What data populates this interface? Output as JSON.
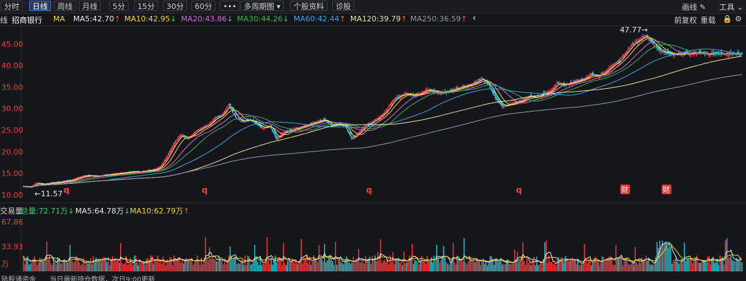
{
  "toolbar": {
    "tabs": [
      "分时",
      "日线",
      "周线",
      "月线",
      "5分",
      "15分",
      "30分",
      "60分",
      "•••"
    ],
    "active_tab": "日线",
    "multi_period": "多周期图 ▾",
    "stock_info": "个股资料",
    "diagnose": "诊股",
    "draw_line": "画线",
    "tools": "工具"
  },
  "ma_bar": {
    "left_cut": "线",
    "stock_name": "招商银行",
    "ma_label": "MA",
    "items": [
      {
        "text": "MA5:42.70",
        "dir": "up",
        "color": "#e8e8e8"
      },
      {
        "text": "MA10:42.95",
        "dir": "down",
        "color": "#f2d52e"
      },
      {
        "text": "MA20:43.86",
        "dir": "down",
        "color": "#e060e6"
      },
      {
        "text": "MA30:44.26",
        "dir": "down",
        "color": "#2fb44e"
      },
      {
        "text": "MA60:42.44",
        "dir": "up",
        "color": "#3aa3e3"
      },
      {
        "text": "MA120:39.79",
        "dir": "up",
        "color": "#e8e0a0"
      },
      {
        "text": "MA250:36.59",
        "dir": "up",
        "color": "#9098a8"
      }
    ],
    "collapse": "‹",
    "restore": "前复权",
    "reset": "重载"
  },
  "volume_bar": {
    "title": "交易量",
    "total": "总量:72.71万",
    "total_dir": "down",
    "ma5": "MA5:64.78万",
    "ma5_dir": "down",
    "ma10": "MA10:62.79万",
    "ma10_dir": "up"
  },
  "footer": {
    "text_1": "陆股通资金",
    "text_2": "当日最新持仓数据，次日9:00更新"
  },
  "colors": {
    "up": "#ff3b3b",
    "down": "#20c9d6",
    "ma5": "#e8e8e8",
    "ma10": "#f2d52e",
    "ma20": "#e060e6",
    "ma30": "#2fb44e",
    "ma60": "#3aa3e3",
    "ma120": "#e8e0a0",
    "ma250": "#9098a8"
  },
  "chart_data": [
    {
      "type": "candlestick",
      "stock": "招商银行",
      "y_ticks": [
        "45.00",
        "40.00",
        "35.00",
        "30.00",
        "25.00",
        "20.00",
        "15.00",
        "10.00"
      ],
      "ylim": [
        9.5,
        48.5
      ],
      "grid": false,
      "annotations": {
        "high": "47.77→",
        "low": "←11.57"
      },
      "markers": [
        "q",
        "q",
        "q",
        "q",
        "财",
        "财"
      ],
      "close_series": {
        "index": [
          0,
          5,
          10,
          15,
          20,
          25,
          30,
          35,
          40,
          45,
          50,
          55,
          60,
          65,
          70,
          75,
          80,
          85,
          90,
          95,
          100,
          105,
          110,
          115,
          120,
          125,
          130,
          135,
          140,
          145,
          150,
          155,
          160,
          165,
          170,
          175,
          180,
          185,
          190,
          195,
          200,
          205,
          210,
          215,
          220,
          225,
          230,
          235,
          240,
          245,
          250,
          255,
          260,
          265,
          270,
          275,
          280,
          285,
          290,
          295,
          300,
          305,
          310,
          315,
          320,
          325,
          330,
          335,
          340,
          345,
          350,
          355,
          360,
          365,
          370,
          375,
          380,
          385,
          390,
          395,
          400,
          405,
          410,
          415,
          420,
          425,
          430,
          435,
          440,
          445,
          450,
          455,
          460,
          465,
          470,
          475,
          480,
          485,
          490,
          495,
          500,
          505,
          510,
          515,
          520,
          525
        ],
        "values": [
          12.0,
          11.8,
          12.8,
          12.4,
          12.8,
          12.9,
          13.2,
          13.4,
          14.0,
          14.5,
          14.4,
          14.3,
          14.6,
          14.8,
          15.0,
          15.2,
          15.4,
          15.3,
          15.6,
          15.8,
          16.5,
          19.0,
          22.0,
          24.0,
          23.0,
          24.5,
          25.5,
          26.2,
          27.8,
          28.5,
          31.0,
          28.0,
          27.0,
          27.5,
          26.5,
          25.5,
          26.0,
          23.0,
          24.5,
          25.0,
          25.5,
          26.0,
          26.5,
          27.0,
          27.5,
          26.0,
          26.5,
          26.0,
          23.0,
          24.5,
          26.0,
          27.0,
          28.0,
          29.5,
          32.0,
          33.0,
          33.5,
          33.0,
          33.5,
          34.5,
          34.0,
          33.5,
          34.0,
          34.5,
          35.0,
          35.5,
          36.0,
          37.0,
          35.5,
          32.5,
          30.5,
          31.0,
          31.5,
          32.0,
          33.0,
          32.5,
          33.5,
          34.0,
          36.0,
          35.5,
          36.0,
          36.5,
          37.0,
          38.0,
          37.5,
          38.5,
          40.0,
          41.0,
          43.0,
          45.0,
          46.0,
          47.0,
          45.0,
          43.5,
          43.0,
          42.5,
          42.7,
          42.8,
          42.9,
          43.0,
          42.6,
          42.8,
          42.7,
          42.8,
          42.7,
          42.7
        ]
      }
    },
    {
      "type": "bar",
      "title": "交易量",
      "unit": "万",
      "y_ticks": [
        "67.86",
        "33.93",
        "万"
      ],
      "ylim": [
        0,
        67.86
      ],
      "series_summary": {
        "total": 72.71,
        "ma5": 64.78,
        "ma10": 62.79
      }
    }
  ]
}
